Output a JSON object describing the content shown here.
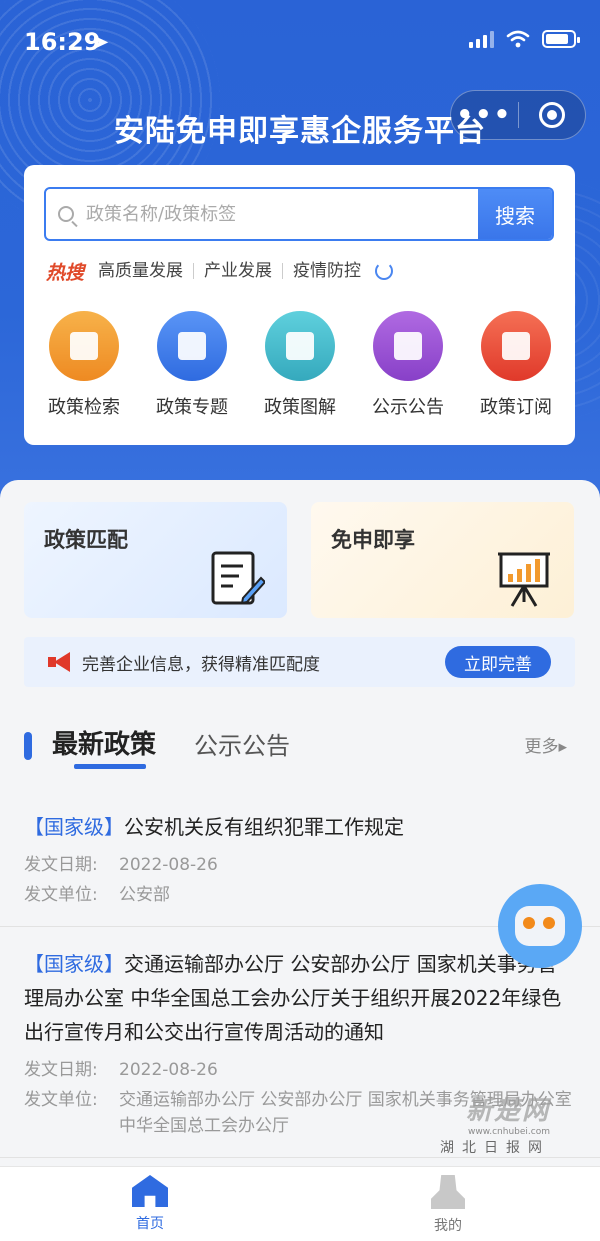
{
  "status_bar": {
    "time": "16:29"
  },
  "capsule": {
    "more": "•••"
  },
  "header": {
    "title": "安陆免申即享惠企服务平台"
  },
  "search": {
    "placeholder": "政策名称/政策标签",
    "button": "搜索"
  },
  "hot_search": {
    "label": "热搜",
    "terms": [
      "高质量发展",
      "产业发展",
      "疫情防控"
    ]
  },
  "categories": [
    {
      "label": "政策检索",
      "color": "#f29a2e"
    },
    {
      "label": "政策专题",
      "color": "#3b7cf0"
    },
    {
      "label": "政策图解",
      "color": "#45b9c9"
    },
    {
      "label": "公示公告",
      "color": "#9a4fd0"
    },
    {
      "label": "政策订阅",
      "color": "#ee5538"
    }
  ],
  "feature_tiles": [
    {
      "title": "政策匹配"
    },
    {
      "title": "免申即享"
    }
  ],
  "banner": {
    "text": "完善企业信息，获得精准匹配度",
    "button": "立即完善"
  },
  "tabs": {
    "active": "最新政策",
    "other": "公示公告",
    "more": "更多▸"
  },
  "news": [
    {
      "tag": "【国家级】",
      "title": "公安机关反有组织犯罪工作规定",
      "date_label": "发文日期:",
      "date": "2022-08-26",
      "unit_label": "发文单位:",
      "unit": "公安部"
    },
    {
      "tag": "【国家级】",
      "title": "交通运输部办公厅 公安部办公厅 国家机关事务管理局办公室 中华全国总工会办公厅关于组织开展2022年绿色出行宣传月和公交出行宣传周活动的通知",
      "date_label": "发文日期:",
      "date": "2022-08-26",
      "unit_label": "发文单位:",
      "unit": "交通运输部办公厅 公安部办公厅 国家机关事务管理局办公室 中华全国总工会办公厅"
    }
  ],
  "tabbar": {
    "home": "首页",
    "me": "我的"
  },
  "watermark": {
    "line1": "新楚网",
    "line2": "www.cnhubei.com",
    "line3": "湖北日报网"
  },
  "colors": {
    "primary": "#2f6be0",
    "hot": "#e04a2a",
    "banner_bg": "#eaf1fd"
  }
}
